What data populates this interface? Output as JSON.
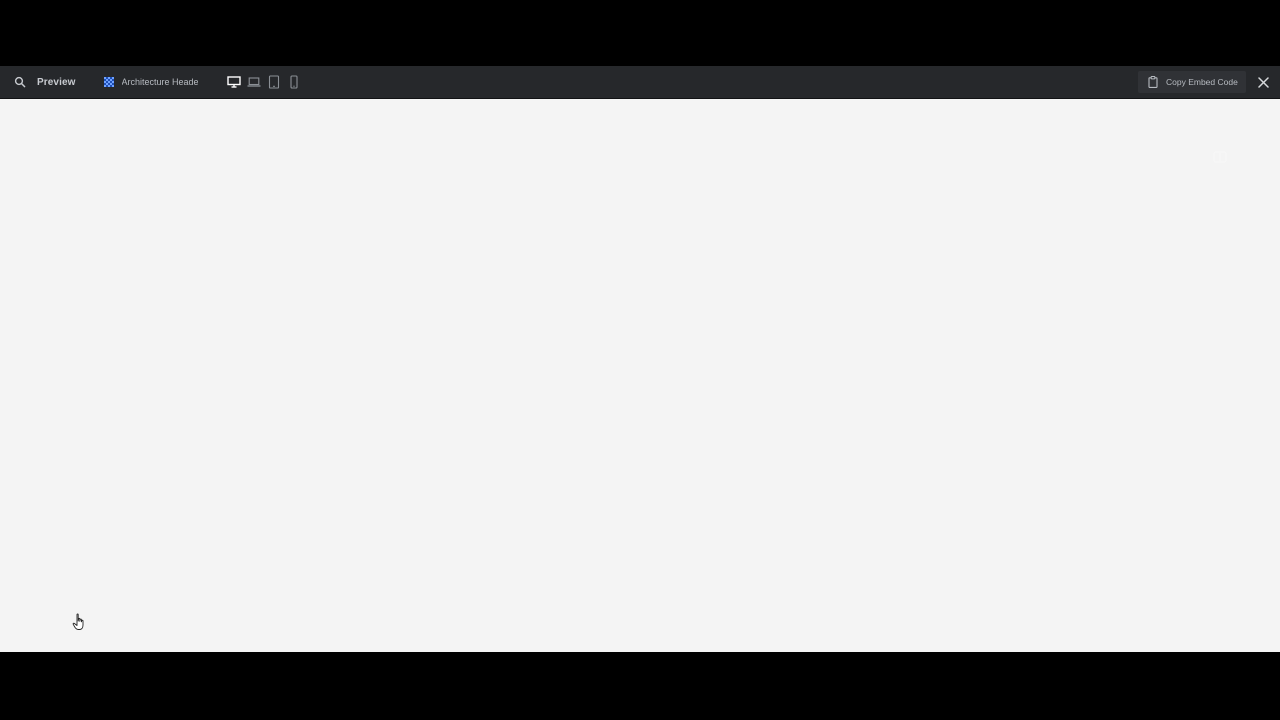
{
  "toolbar": {
    "title": "Preview",
    "project_name": "Architecture Header",
    "embed_label": "Copy Embed Code",
    "icons": {
      "search": "search-icon",
      "project": "grid-pattern-icon",
      "desktop": "desktop-icon",
      "laptop": "laptop-icon",
      "tablet": "tablet-icon",
      "mobile": "mobile-icon",
      "clipboard": "clipboard-icon",
      "close": "close-icon"
    },
    "active_device": "desktop"
  },
  "colors": {
    "toolbar_bg": "#26282b",
    "canvas_bg": "#f4f4f4",
    "outer_bg": "#000000",
    "accent": "#3d7cf5"
  }
}
